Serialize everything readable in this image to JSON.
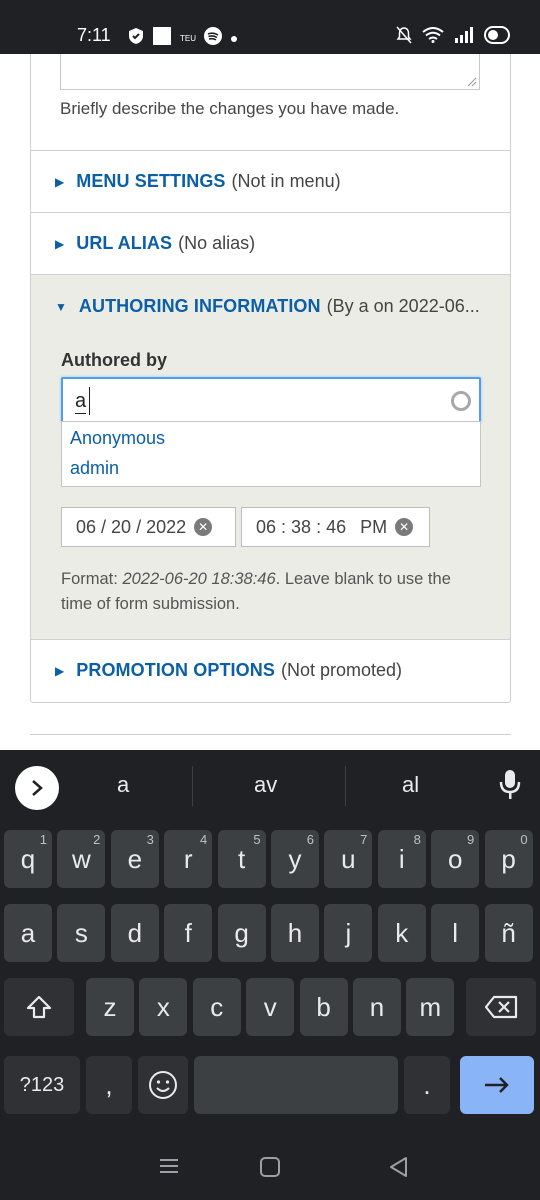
{
  "status_bar": {
    "time": "7:11",
    "small_label": "TEU"
  },
  "form": {
    "description": "Briefly describe the changes you have made.",
    "menu_settings": {
      "title": "MENU SETTINGS",
      "summary": "(Not in menu)"
    },
    "url_alias": {
      "title": "URL ALIAS",
      "summary": "(No alias)"
    },
    "authoring": {
      "title": "AUTHORING INFORMATION",
      "summary": "(By a on 2022-06...",
      "authored_by_label": "Authored by",
      "authored_by_value": "a",
      "suggestions": [
        "Anonymous",
        "admin"
      ],
      "date": {
        "month": "06",
        "day": "20",
        "year": "2022"
      },
      "time": {
        "hour": "06",
        "minute": "38",
        "second": "46",
        "ampm": "PM"
      },
      "format_prefix": "Format: ",
      "format_example": "2022-06-20 18:38:46",
      "format_suffix": ". Leave blank to use the time of form submission."
    },
    "promotion": {
      "title": "PROMOTION OPTIONS",
      "summary": "(Not promoted)"
    }
  },
  "keyboard": {
    "suggestions": [
      "a",
      "av",
      "al"
    ],
    "row1": [
      {
        "k": "q",
        "h": "1"
      },
      {
        "k": "w",
        "h": "2"
      },
      {
        "k": "e",
        "h": "3"
      },
      {
        "k": "r",
        "h": "4"
      },
      {
        "k": "t",
        "h": "5"
      },
      {
        "k": "y",
        "h": "6"
      },
      {
        "k": "u",
        "h": "7"
      },
      {
        "k": "i",
        "h": "8"
      },
      {
        "k": "o",
        "h": "9"
      },
      {
        "k": "p",
        "h": "0"
      }
    ],
    "row2": [
      "a",
      "s",
      "d",
      "f",
      "g",
      "h",
      "j",
      "k",
      "l",
      "ñ"
    ],
    "row3": [
      "z",
      "x",
      "c",
      "v",
      "b",
      "n",
      "m"
    ],
    "symbols_label": "?123",
    "comma_label": ",",
    "period_label": "."
  },
  "colors": {
    "link_blue": "#0a5fa8",
    "focus_blue": "#4d9fe9",
    "keyboard_bg": "#202124",
    "enter_key": "#8ab4f8"
  }
}
